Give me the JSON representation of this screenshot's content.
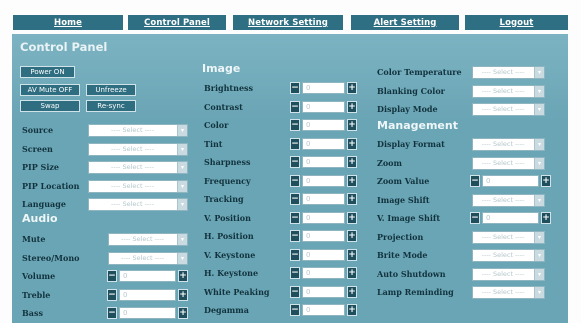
{
  "nav": {
    "home": "Home",
    "control_panel": "Control Panel",
    "network_setting": "Network Setting",
    "alert_setting": "Alert Setting",
    "logout": "Logout"
  },
  "page_title": "Control Panel",
  "buttons": {
    "power_on": "Power ON",
    "av_mute_off": "AV Mute OFF",
    "unfreeze": "Unfreeze",
    "swap": "Swap",
    "resync": "Re-sync"
  },
  "select_placeholder": "---- Select ----",
  "select_placeholder_short": "---- Select ----",
  "stepper_value": "0",
  "left": {
    "rows": [
      {
        "label": "Source"
      },
      {
        "label": "Screen"
      },
      {
        "label": "PIP Size"
      },
      {
        "label": "PIP Location"
      },
      {
        "label": "Language"
      }
    ],
    "audio_title": "Audio",
    "audio_selects": [
      {
        "label": "Mute"
      },
      {
        "label": "Stereo/Mono"
      }
    ],
    "audio_steppers": [
      {
        "label": "Volume"
      },
      {
        "label": "Treble"
      },
      {
        "label": "Bass"
      }
    ]
  },
  "middle": {
    "image_title": "Image",
    "rows": [
      {
        "label": "Brightness"
      },
      {
        "label": "Contrast"
      },
      {
        "label": "Color"
      },
      {
        "label": "Tint"
      },
      {
        "label": "Sharpness"
      },
      {
        "label": "Frequency"
      },
      {
        "label": "Tracking"
      },
      {
        "label": "V. Position"
      },
      {
        "label": "H. Position"
      },
      {
        "label": "V. Keystone"
      },
      {
        "label": "H. Keystone"
      },
      {
        "label": "White Peaking"
      },
      {
        "label": "Degamma"
      }
    ]
  },
  "right": {
    "top_rows": [
      {
        "label": "Color Temperature"
      },
      {
        "label": "Blanking Color"
      },
      {
        "label": "Display Mode"
      }
    ],
    "management_title": "Management",
    "mgmt_rows": [
      {
        "label": "Display Format",
        "kind": "select"
      },
      {
        "label": "Zoom",
        "kind": "select"
      },
      {
        "label": "Zoom Value",
        "kind": "stepper"
      },
      {
        "label": "Image Shift",
        "kind": "select"
      },
      {
        "label": "V. Image Shift",
        "kind": "stepper"
      },
      {
        "label": "Projection",
        "kind": "select"
      },
      {
        "label": "Brite Mode",
        "kind": "select"
      },
      {
        "label": "Auto Shutdown",
        "kind": "select"
      },
      {
        "label": "Lamp Reminding",
        "kind": "select"
      }
    ]
  }
}
